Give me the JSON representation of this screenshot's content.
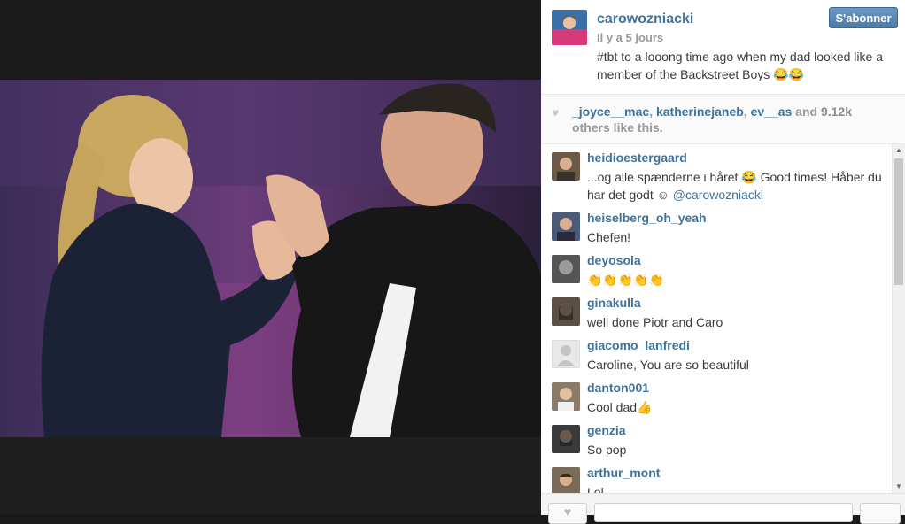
{
  "post": {
    "owner": "carowozniacki",
    "time": "Il y a 5 jours",
    "caption": "#tbt to a looong time ago when my dad looked like a member of the Backstreet Boys 😂😂",
    "follow_label": "S'abonner"
  },
  "likes": {
    "users": [
      "_joyce__mac",
      "katherinejaneb",
      "ev__as"
    ],
    "separator": ", ",
    "and": " and ",
    "count": "9.12k",
    "suffix": "others like this."
  },
  "comments": [
    {
      "user": "heidioestergaard",
      "text": "...og alle spænderne i håret 😂 Good times! Håber du har det godt ☺ ",
      "mention": "@carowozniacki",
      "avatar_color": "#6b5a48"
    },
    {
      "user": "heiselberg_oh_yeah",
      "text": "Chefen!",
      "mention": "",
      "avatar_color": "#4a5a78"
    },
    {
      "user": "deyosola",
      "text": "👏👏👏👏👏",
      "mention": "",
      "avatar_color": "#555555"
    },
    {
      "user": "ginakulla",
      "text": "well done Piotr and Caro",
      "mention": "",
      "avatar_color": "#5a5046"
    },
    {
      "user": "giacomo_lanfredi",
      "text": "Caroline, You are so beautiful",
      "mention": "",
      "avatar_color": "#d9d9d9"
    },
    {
      "user": "danton001",
      "text": "Cool dad👍",
      "mention": "",
      "avatar_color": "#8a7a68"
    },
    {
      "user": "genzia",
      "text": "So pop",
      "mention": "",
      "avatar_color": "#3a3a3a"
    },
    {
      "user": "arthur_mont",
      "text": "Lol",
      "mention": "",
      "avatar_color": "#7a6a58"
    }
  ],
  "footer": {
    "comment_placeholder": ""
  },
  "colors": {
    "link": "#3f729b",
    "follow_button": "#5585b5"
  }
}
